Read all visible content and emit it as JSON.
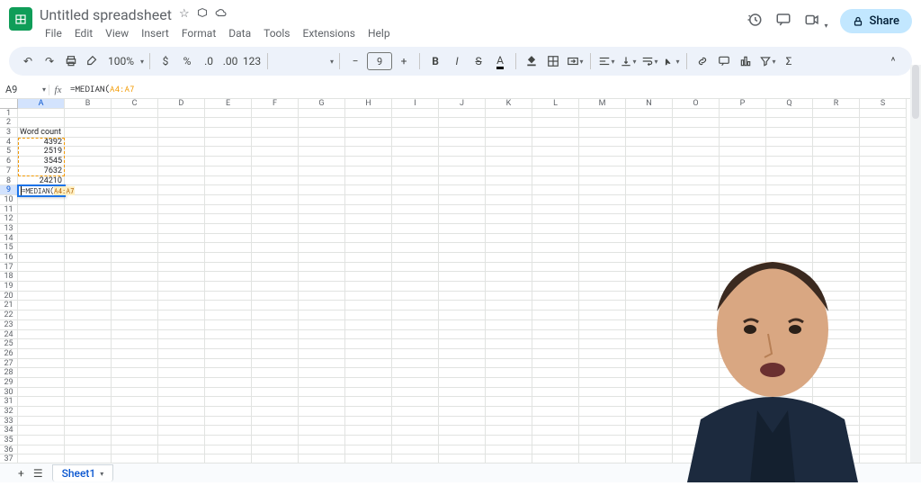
{
  "header": {
    "doc_title": "Untitled spreadsheet",
    "menus": [
      "File",
      "Edit",
      "View",
      "Insert",
      "Format",
      "Data",
      "Tools",
      "Extensions",
      "Help"
    ],
    "share_label": "Share"
  },
  "toolbar": {
    "zoom": "100%",
    "font_size": "9"
  },
  "formula_bar": {
    "name_box": "A9",
    "formula_prefix": "=MEDIAN(",
    "formula_range": "A4:A7",
    "formula_suffix": ""
  },
  "columns": [
    "A",
    "B",
    "C",
    "D",
    "E",
    "F",
    "G",
    "H",
    "I",
    "J",
    "K",
    "L",
    "M",
    "N",
    "O",
    "P",
    "Q",
    "R",
    "S"
  ],
  "data": {
    "A3": "Word count",
    "A4": "4392",
    "A5": "2519",
    "A6": "3545",
    "A7": "7632",
    "A8": "24210"
  },
  "selection": {
    "active": "A9",
    "active_display_prefix": "=MEDIAN(",
    "active_display_range": "A4:A7",
    "range_start_row": 4,
    "range_end_row": 7
  },
  "sheet_tab": "Sheet1",
  "row_count": 40
}
